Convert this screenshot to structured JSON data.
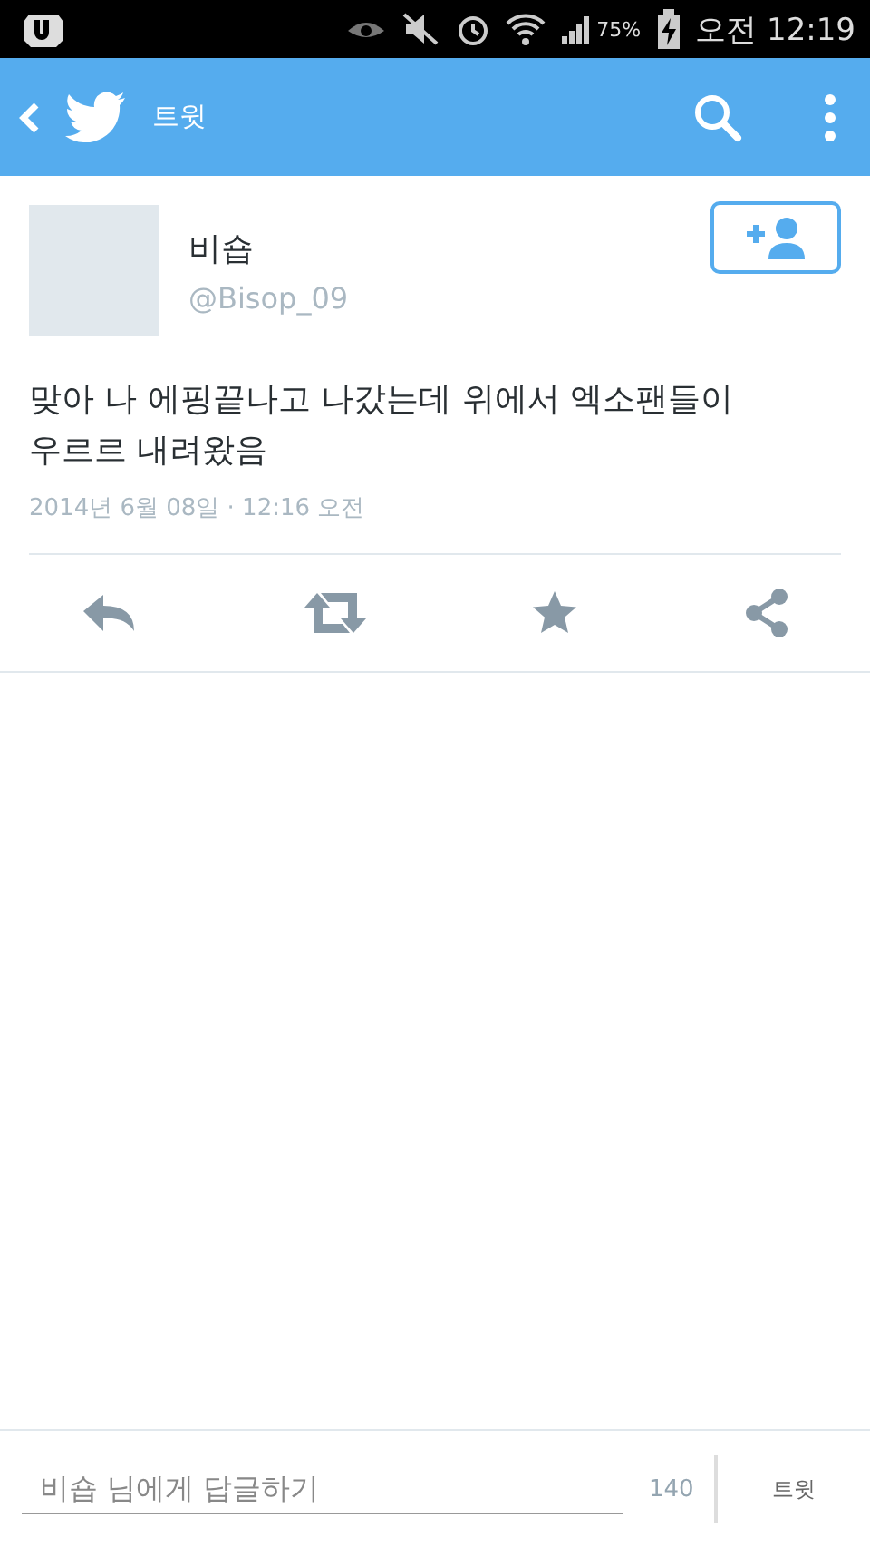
{
  "status_bar": {
    "battery": "75%",
    "time": "오전 12:19"
  },
  "app_bar": {
    "title": "트윗"
  },
  "tweet": {
    "name": "비숍",
    "handle": "@Bisop_09",
    "text": "맞아 나 에핑끝나고 나갔는데 위에서 엑소팬들이 우르르 내려왔음",
    "timestamp": "2014년 6월 08일 · 12:16 오전"
  },
  "reply_bar": {
    "placeholder": "비숍 님에게 답글하기",
    "counter": "140",
    "button": "트윗"
  }
}
